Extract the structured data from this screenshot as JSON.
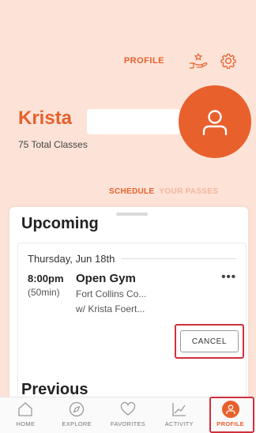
{
  "header": {
    "profile_tab": "PROFILE",
    "icons": [
      "hand-star-icon",
      "gear-icon"
    ]
  },
  "user": {
    "name": "Krista",
    "total_classes": "75 Total Classes"
  },
  "sub_tabs": {
    "schedule": "SCHEDULE",
    "passes": "YOUR PASSES"
  },
  "upcoming": {
    "title": "Upcoming",
    "date": "Thursday, Jun 18th",
    "time": "8:00pm",
    "duration": "(50min)",
    "class_name": "Open Gym",
    "location": "Fort Collins Co...",
    "instructor": "w/ Krista Foert...",
    "more": "•••",
    "cancel": "CANCEL"
  },
  "previous": {
    "title": "Previous"
  },
  "nav": {
    "items": [
      {
        "label": "HOME",
        "icon": "home-icon"
      },
      {
        "label": "EXPLORE",
        "icon": "compass-icon"
      },
      {
        "label": "FAVORITES",
        "icon": "heart-icon"
      },
      {
        "label": "ACTIVITY",
        "icon": "chart-icon"
      },
      {
        "label": "PROFILE",
        "icon": "profile-icon"
      }
    ]
  },
  "colors": {
    "accent": "#e8602c",
    "background": "#fde3d7",
    "highlight_outline": "#d0303a"
  }
}
